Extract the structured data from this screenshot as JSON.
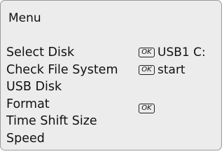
{
  "menu": {
    "title": "Menu",
    "items": [
      {
        "label": "Select  Disk",
        "has_ok": true,
        "ok_text": "OK",
        "value": "USB1 C:"
      },
      {
        "label": "Check File System",
        "has_ok": true,
        "ok_text": "OK",
        "value": "start"
      },
      {
        "label": "USB Disk",
        "has_ok": false,
        "ok_text": "",
        "value": ""
      },
      {
        "label": "Format",
        "has_ok": true,
        "ok_text": "OK",
        "value": ""
      },
      {
        "label": "Time Shift Size",
        "has_ok": false,
        "ok_text": "",
        "value": ""
      },
      {
        "label": "Speed",
        "has_ok": false,
        "ok_text": "",
        "value": ""
      }
    ]
  }
}
